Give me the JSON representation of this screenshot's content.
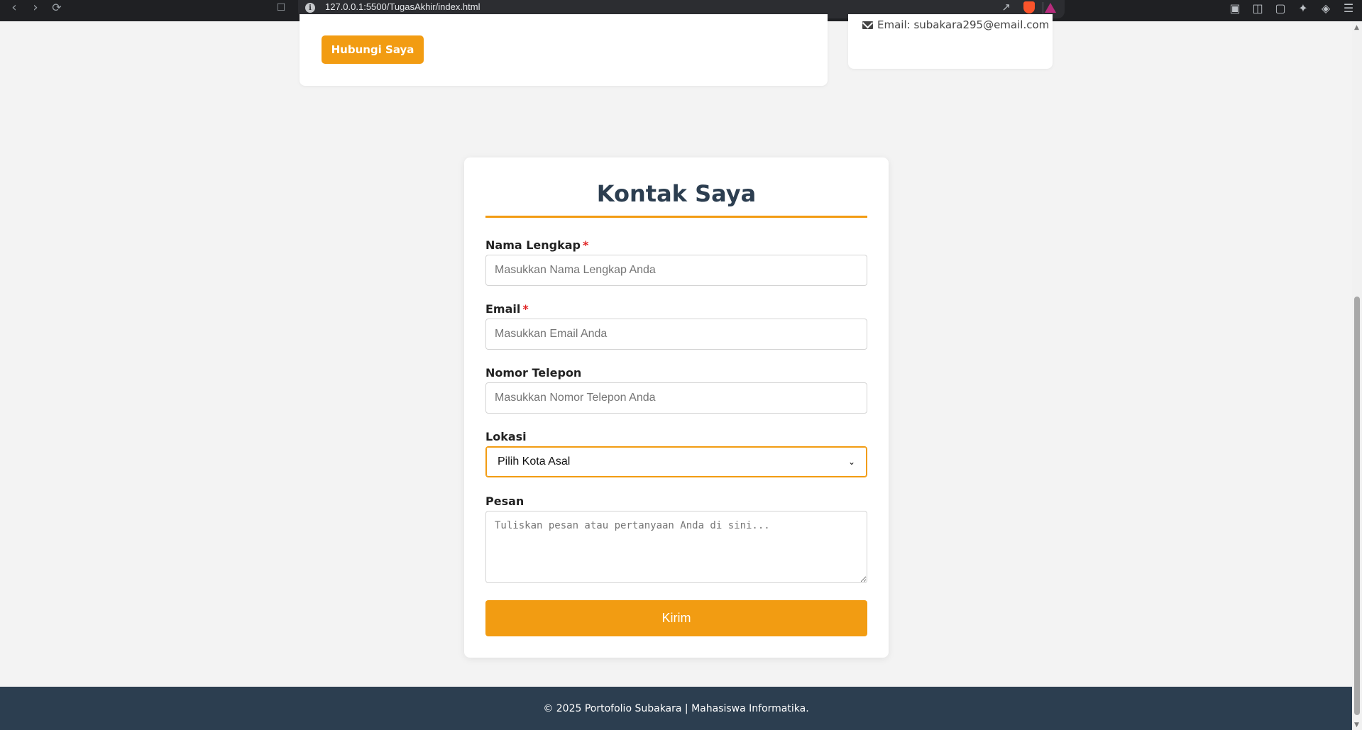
{
  "browser": {
    "url": "127.0.0.1:5500/TugasAkhir/index.html",
    "back_icon": "chevron-left-icon",
    "forward_icon": "chevron-right-icon",
    "reload_icon": "reload-icon",
    "bookmark_icon": "bookmark-icon"
  },
  "top_section": {
    "button_label": "Hubungi Saya",
    "side_email": "Email: subakara295@email.com"
  },
  "form": {
    "title": "Kontak Saya",
    "name": {
      "label": "Nama Lengkap",
      "required_mark": "*",
      "placeholder": "Masukkan Nama Lengkap Anda"
    },
    "email": {
      "label": "Email",
      "required_mark": "*",
      "placeholder": "Masukkan Email Anda"
    },
    "phone": {
      "label": "Nomor Telepon",
      "placeholder": "Masukkan Nomor Telepon Anda"
    },
    "location": {
      "label": "Lokasi",
      "selected": "Pilih Kota Asal"
    },
    "message": {
      "label": "Pesan",
      "placeholder": "Tuliskan pesan atau pertanyaan Anda di sini..."
    },
    "submit_label": "Kirim"
  },
  "footer": {
    "text": "© 2025 Portofolio Subakara | Mahasiswa Informatika."
  },
  "colors": {
    "accent": "#f29c12",
    "heading": "#2c3e50",
    "footer_bg": "#2c3e50",
    "page_bg": "#f3f3f3"
  }
}
